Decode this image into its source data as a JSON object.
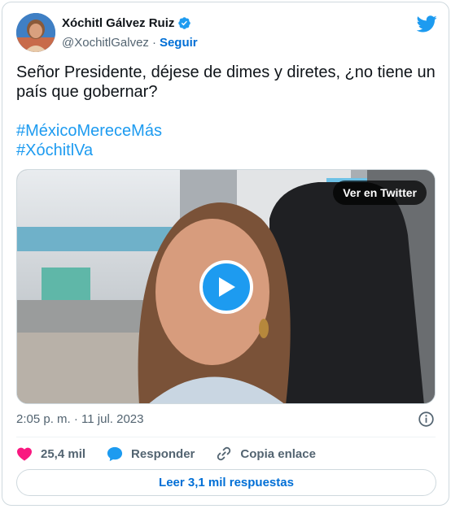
{
  "author": {
    "name": "Xóchitl Gálvez Ruiz",
    "handle": "@XochitlGalvez",
    "separator": "·",
    "follow_label": "Seguir"
  },
  "tweet": {
    "text": "Señor Presidente, déjese de dimes y diretes, ¿no tiene un país que gobernar?",
    "hashtags": [
      "#MéxicoMereceMás",
      "#XóchitlVa"
    ]
  },
  "media": {
    "view_label": "Ver en Twitter"
  },
  "timestamp": "2:05 p. m. · 11 jul. 2023",
  "actions": {
    "likes": "25,4 mil",
    "reply_label": "Responder",
    "copy_link_label": "Copia enlace"
  },
  "replies_button": "Leer 3,1 mil respuestas",
  "colors": {
    "accent": "#1d9bf0",
    "link": "#006fd6",
    "like": "#f91880",
    "muted": "#536471",
    "border": "#cfd9de"
  },
  "icons": [
    "verified-badge-icon",
    "twitter-bird-icon",
    "play-icon",
    "info-icon",
    "heart-icon",
    "reply-bubble-icon",
    "link-icon"
  ]
}
